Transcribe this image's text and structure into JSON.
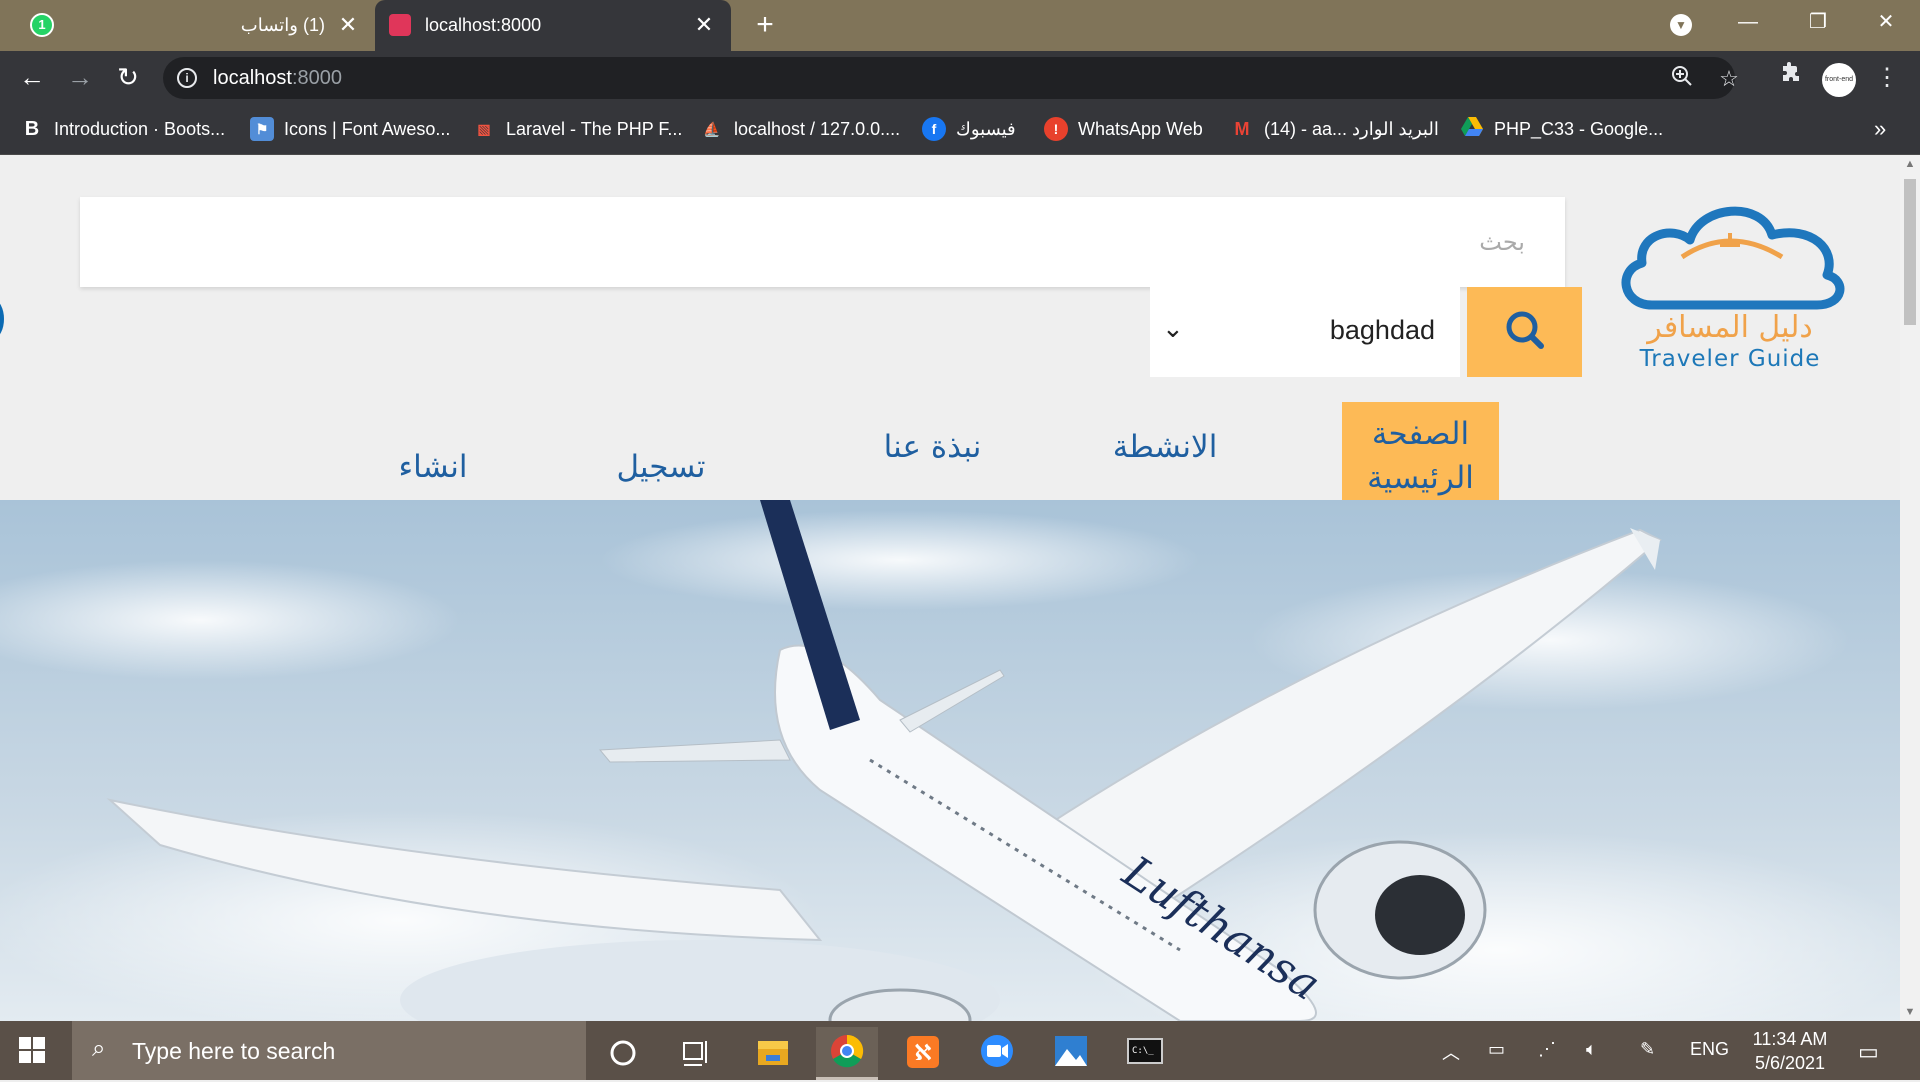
{
  "browser": {
    "tabs": [
      {
        "title": "(1) واتساب",
        "badge": "1",
        "active": false
      },
      {
        "title": "localhost:8000",
        "active": true
      }
    ],
    "address": {
      "host": "localhost",
      "port": ":8000"
    },
    "profile_label": "front-end",
    "bookmarks": [
      {
        "label": "Introduction · Boots...",
        "icon": "bootstrap-icon"
      },
      {
        "label": "Icons | Font Aweso...",
        "icon": "font-awesome-icon"
      },
      {
        "label": "Laravel - The PHP F...",
        "icon": "laravel-icon"
      },
      {
        "label": "localhost / 127.0.0....",
        "icon": "phpmyadmin-icon"
      },
      {
        "label": "فيسبوك",
        "icon": "facebook-icon"
      },
      {
        "label": "WhatsApp Web",
        "icon": "whatsapp-icon"
      },
      {
        "label": "(14) - aa... البريد الوارد",
        "icon": "gmail-icon"
      },
      {
        "label": "PHP_C33 - Google...",
        "icon": "google-drive-icon"
      }
    ]
  },
  "page": {
    "search_placeholder": "بحث",
    "city_selected": "baghdad",
    "logo_ar": "دليل المسافر",
    "logo_en": "Traveler Guide",
    "nav": [
      {
        "label": "الصفحة الرئيسية",
        "active": true
      },
      {
        "label": "الانشطة"
      },
      {
        "label": "نبذة عنا"
      },
      {
        "label": "تسجيل"
      },
      {
        "label": "انشاء"
      }
    ],
    "hero_airline": "Lufthansa",
    "accent_color": "#fdba56",
    "nav_color": "#1f5fa0"
  },
  "taskbar": {
    "search_placeholder": "Type here to search",
    "language": "ENG",
    "time": "11:34 AM",
    "date": "5/6/2021"
  }
}
